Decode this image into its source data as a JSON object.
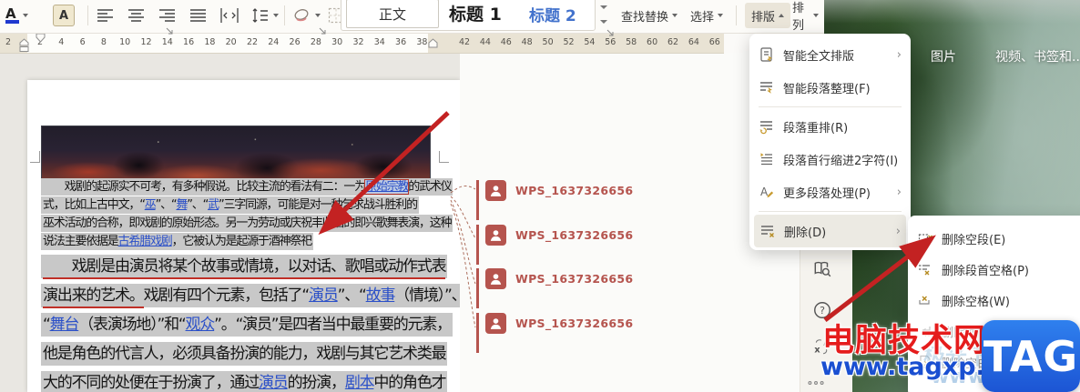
{
  "toolbar": {
    "styles": [
      "正文",
      "标题 1",
      "标题 2"
    ],
    "find_replace_label": "查找替换",
    "select_label": "选择",
    "typeset_label": "排版",
    "arrange_label": "排列"
  },
  "ruler": {
    "margin_number": "2",
    "white_numbers": [
      2,
      4,
      6,
      8,
      10,
      12,
      14,
      16,
      18,
      20,
      22,
      24,
      26,
      28,
      30,
      32,
      34,
      36,
      38
    ],
    "right_numbers": [
      42,
      44,
      46,
      48,
      50,
      52,
      54,
      56,
      58,
      60,
      62,
      64,
      66
    ]
  },
  "document": {
    "para1_lines": [
      {
        "segs": [
          {
            "t": "　　戏剧的起源实不可考，有多种假说。比较主流的看法有二：一为"
          },
          {
            "t": "原始宗教",
            "link": true,
            "boxed": true
          },
          {
            "t": "的武术仪"
          }
        ]
      },
      {
        "segs": [
          {
            "t": "式，比如上古中文，“"
          },
          {
            "t": "巫",
            "link": true
          },
          {
            "t": "”、“"
          },
          {
            "t": "舞",
            "link": true
          },
          {
            "t": "”、“"
          },
          {
            "t": "武",
            "link": true
          },
          {
            "t": "”三字同源，可能是对一种乞求战斗胜利的"
          }
        ]
      },
      {
        "segs": [
          {
            "t": "巫术活动的合称，即戏剧的原始形态。另一为劳动或庆祝丰收后的即兴歌舞表演，这种"
          }
        ]
      },
      {
        "segs": [
          {
            "t": "说法主要依据是"
          },
          {
            "t": "古希腊戏剧",
            "link": true
          },
          {
            "t": "，它被认为是起源于酒神祭祀"
          }
        ]
      }
    ],
    "para2_lines": [
      {
        "segs": [
          {
            "t": "　　戏剧是由演员将某个故事或情境，以对话、歌唱或动作式表",
            "ins": true
          }
        ]
      },
      {
        "segs": [
          {
            "t": "演出来的艺术。",
            "ins": true
          },
          {
            "t": "戏剧有四个元素，包括了“"
          },
          {
            "t": "演员",
            "link": true
          },
          {
            "t": "”、“"
          },
          {
            "t": "故事",
            "link": true
          },
          {
            "t": "（情境）”、"
          }
        ]
      },
      {
        "segs": [
          {
            "t": "“"
          },
          {
            "t": "舞台",
            "link": true
          },
          {
            "t": "（表演场地）”和“"
          },
          {
            "t": "观众",
            "link": true
          },
          {
            "t": "”。“演员”是四者当中最重要的元素，"
          }
        ]
      },
      {
        "segs": [
          {
            "t": "他是角色的代言人，必须具备扮演的能力，戏剧与其它艺术类最"
          }
        ]
      },
      {
        "segs": [
          {
            "t": "大的不同的处便在于扮演了，通过"
          },
          {
            "t": "演员",
            "link": true
          },
          {
            "t": "的扮演，"
          },
          {
            "t": "剧本",
            "link": true
          },
          {
            "t": "中的角色才"
          }
        ]
      }
    ]
  },
  "comments": {
    "items": [
      {
        "name": "WPS_1637326656"
      },
      {
        "name": "WPS_1637326656"
      },
      {
        "name": "WPS_1637326656"
      },
      {
        "name": "WPS_1637326656"
      }
    ]
  },
  "menu": {
    "items": [
      {
        "name": "smart-full-typeset",
        "label": "智能全文排版",
        "icon": "doc-magic-icon",
        "submenu": true
      },
      {
        "name": "smart-paragraph-tidy",
        "label": "智能段落整理(F)",
        "icon": "para-magic-icon"
      },
      {
        "divider": true
      },
      {
        "name": "paragraph-rewrap",
        "label": "段落重排(R)",
        "icon": "para-rewrap-icon"
      },
      {
        "name": "first-line-indent",
        "label": "段落首行缩进2字符(I)",
        "icon": "indent-icon"
      },
      {
        "name": "more-paragraph",
        "label": "更多段落处理(P)",
        "icon": "more-para-icon",
        "submenu": true
      },
      {
        "divider": true
      },
      {
        "name": "delete",
        "label": "删除(D)",
        "icon": "delete-lines-icon",
        "submenu": true,
        "highlight": true
      }
    ]
  },
  "submenu": {
    "items": [
      {
        "name": "delete-empty-paragraph",
        "label": "删除空段(E)",
        "icon": "delete-empty-para-icon"
      },
      {
        "name": "delete-leading-spaces",
        "label": "删除段首空格(P)",
        "icon": "delete-leading-space-icon"
      },
      {
        "name": "delete-spaces",
        "label": "删除空格(W)",
        "icon": "delete-space-icon"
      },
      {
        "name": "delete-line-breaks",
        "label": "删除换行符(S)",
        "icon": "delete-linebreak-icon",
        "faded": true
      },
      {
        "name": "delete-blank-page",
        "label": "删除空白页(B)",
        "icon": "delete-blank-page-icon",
        "faded": true
      }
    ]
  },
  "sidebar": {
    "icons": [
      "doc-search-icon",
      "help-icon",
      "translate-icon",
      "more-dots-icon"
    ]
  },
  "desktop": {
    "labels": [
      "图片",
      "视频、书签和..."
    ]
  },
  "watermark": {
    "site_name": "电脑技术网",
    "site_url": "www.tagxp.com",
    "logo_text": "TAG",
    "faint_brand": "极光下载站",
    "faint_url": "www.xz7.com"
  },
  "colors": {
    "selection": "#c8c8c8",
    "comment_accent": "#b5544e",
    "link": "#2b50c8",
    "menu_highlight": "#eceae3",
    "watermark_red": "#e51c1c",
    "watermark_blue": "#1a4fd1",
    "logo_blue": "#1c55d4",
    "insert_mark_red": "#c03028",
    "arrow_red": "#c32222"
  }
}
